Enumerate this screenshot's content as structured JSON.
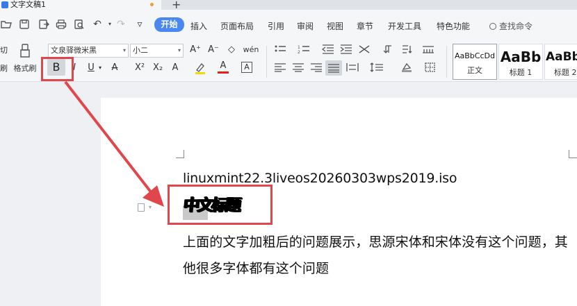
{
  "window": {
    "doc_title": "文字文稿1",
    "new_tab": "+"
  },
  "menu": {
    "items": [
      "开始",
      "插入",
      "页面布局",
      "引用",
      "审阅",
      "视图",
      "章节",
      "开发工具",
      "特色功能"
    ],
    "search": "查找命令",
    "undo_glyph": "↶",
    "redo_glyph": "↷",
    "more_glyph": "▿"
  },
  "ribbon": {
    "cut_label": "切",
    "paste_label": "刷",
    "format_painter_label": "格式刷",
    "font_name": "文泉驿微米黑",
    "font_size": "小二",
    "bold_label": "B",
    "italic_label": "I",
    "underline_label": "U",
    "strike_label": "A",
    "superscript_label": "X²",
    "subscript_label": "X₂",
    "text_effect_label": "A",
    "font_color_label": "A",
    "char_border_label": "A",
    "grow_font_label": "A⁺",
    "shrink_font_label": "A⁻",
    "clear_format_label": "◇",
    "phonetic_label": "wén",
    "styles": [
      {
        "sample": "AaBbCcDd",
        "name": "正文"
      },
      {
        "sample": "AaBb",
        "name": "标题 1"
      },
      {
        "sample": "AaBb",
        "name": "标题 2"
      }
    ]
  },
  "document": {
    "line1": "linuxmint22.3liveos20260303wps2019.iso",
    "line2_garbled": "中文标题",
    "paragraph": "上面的文字加粗后的问题展示，思源宋体和宋体没有这个问题，其他很多字体都有这个问题"
  },
  "colors": {
    "accent": "#4a88f0",
    "annotation": "#e0474c",
    "highlight_yellow": "#f5d800",
    "font_red": "#e02020"
  }
}
